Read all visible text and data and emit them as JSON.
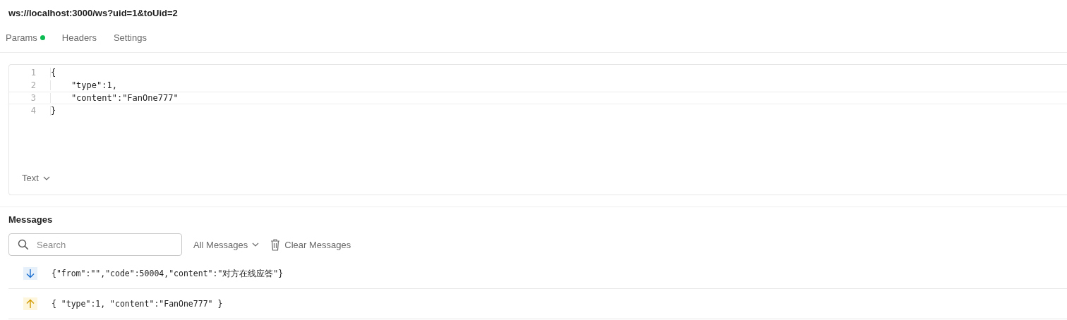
{
  "url": "ws://localhost:3000/ws?uid=1&toUid=2",
  "tabs": [
    {
      "label": "Params",
      "dot": true
    },
    {
      "label": "Headers",
      "dot": false
    },
    {
      "label": "Settings",
      "dot": false
    }
  ],
  "editor": {
    "lines": [
      {
        "number": "1",
        "text": "{",
        "active": false
      },
      {
        "number": "2",
        "text": "    \"type\":1,",
        "active": false
      },
      {
        "number": "3",
        "text": "    \"content\":\"FanOne777\"",
        "active": true
      },
      {
        "number": "4",
        "text": "}",
        "active": false
      }
    ],
    "format": "Text"
  },
  "messages": {
    "title": "Messages",
    "search": {
      "placeholder": "Search"
    },
    "filter": "All Messages",
    "clear": "Clear Messages",
    "items": [
      {
        "kind": "received",
        "text": "{\"from\":\"\",\"code\":50004,\"content\":\"对方在线应答\"}"
      },
      {
        "kind": "sent",
        "text": "{ \"type\":1, \"content\":\"FanOne777\" }"
      }
    ]
  }
}
